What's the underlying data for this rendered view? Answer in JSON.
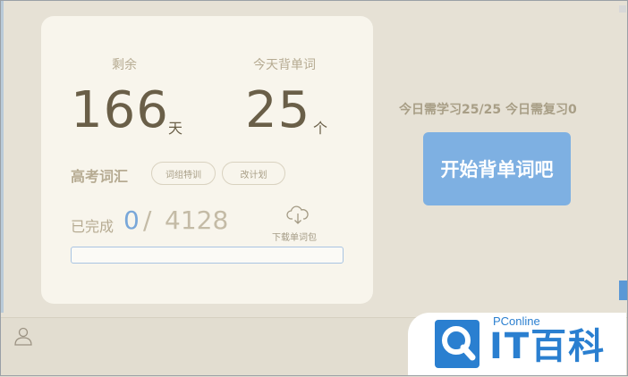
{
  "stats": {
    "remaining_label": "剩余",
    "remaining_value": "166",
    "remaining_unit": "天",
    "today_label": "今天背单词",
    "today_value": "25",
    "today_unit": "个"
  },
  "book": {
    "title": "高考词汇",
    "special_training_label": "词组特训",
    "change_plan_label": "改计划"
  },
  "progress": {
    "label": "已完成",
    "completed": "0",
    "separator": "/",
    "total": "4128",
    "fraction": 0
  },
  "download": {
    "label": "下载单词包",
    "icon": "cloud-download-icon"
  },
  "plan": {
    "text": "今日需学习25/25 今日需复习0"
  },
  "start_button": {
    "label": "开始背单词吧"
  },
  "watermark": {
    "small": "PConline",
    "big": "IT百科"
  },
  "colors": {
    "accent": "#7eb0e2",
    "progress_fill": "#79a7d9",
    "logo": "#2a7fd0"
  }
}
